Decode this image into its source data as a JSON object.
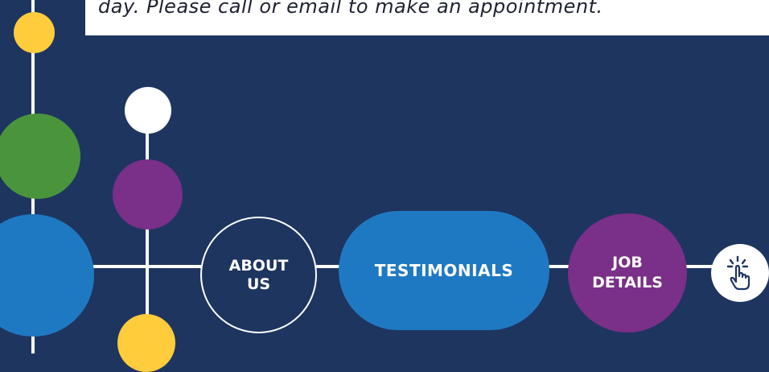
{
  "notice": {
    "text": "day. Please call or email to make an appointment."
  },
  "nav": {
    "about_us": "ABOUT US",
    "testimonials": "TESTIMONIALS",
    "job_details": "JOB DETAILS"
  },
  "icons": {
    "pointer": "pointer-hand-icon"
  },
  "colors": {
    "background": "#1e3560",
    "yellow": "#ffcc3b",
    "green": "#4a943c",
    "purple": "#7a2f88",
    "blue": "#1f79c2",
    "white": "#ffffff"
  }
}
